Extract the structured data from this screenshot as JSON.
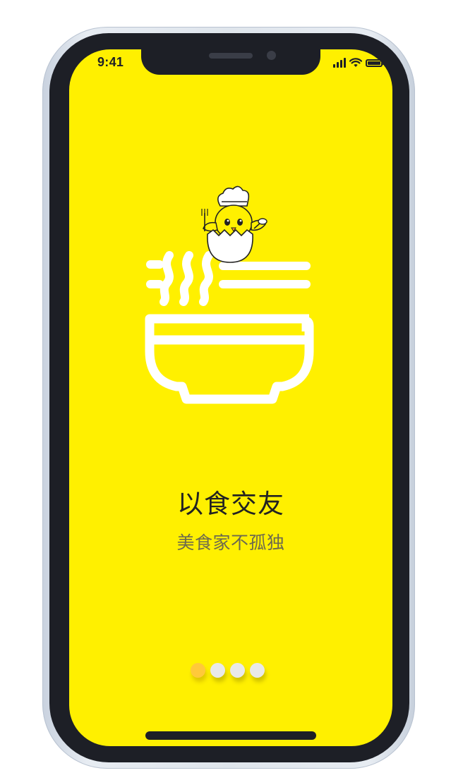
{
  "status_bar": {
    "time": "9:41",
    "icons": [
      "signal-icon",
      "wifi-icon",
      "battery-icon"
    ]
  },
  "onboarding": {
    "title": "以食交友",
    "subtitle": "美食家不孤独",
    "illustration": [
      "chick-chef-mascot",
      "noodle-bowl-icon"
    ],
    "pager": {
      "total": 4,
      "current": 1
    }
  },
  "colors": {
    "screen_background": "#fff000",
    "title": "#222222",
    "subtitle": "#6d6a4e",
    "pager_active": "#ffc93a",
    "pager_inactive": "#e9e9e9",
    "device_bezel": "#1d1f26"
  }
}
